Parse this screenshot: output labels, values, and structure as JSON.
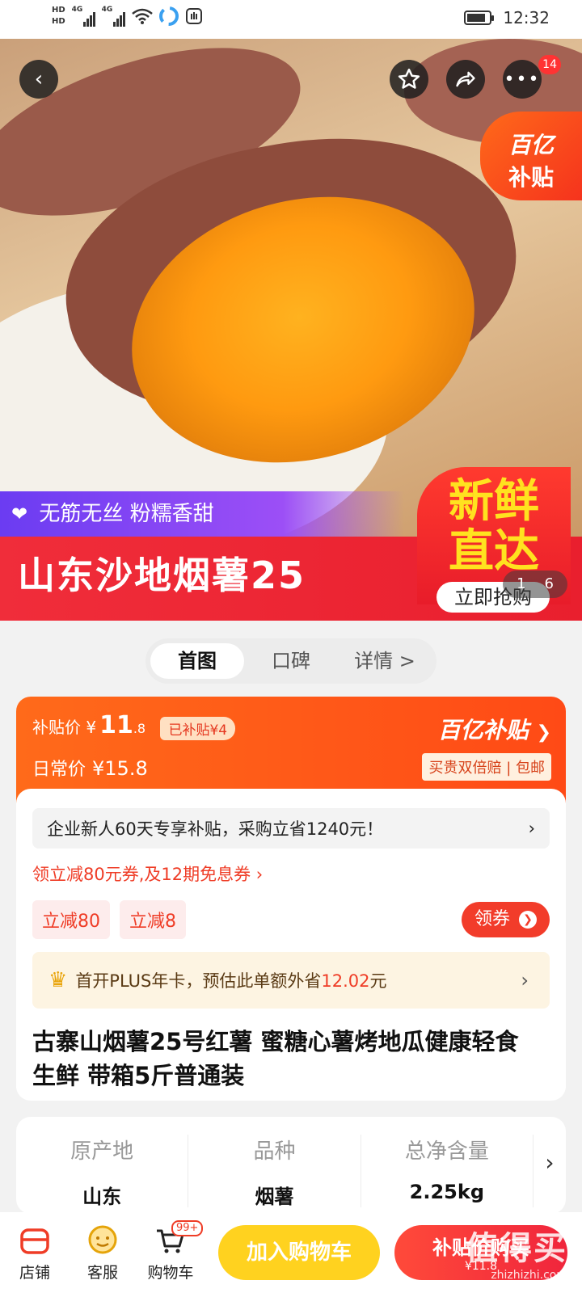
{
  "status_bar": {
    "hd1": "HD",
    "hd2": "HD",
    "net1": "4G",
    "net2": "4G",
    "time": "12:32"
  },
  "hero": {
    "badge_count": "14",
    "yi_badge_line1": "百亿",
    "yi_badge_line2": "补贴",
    "tagline": "无筋无丝  粉糯香甜",
    "title": "山东沙地烟薯25",
    "fresh_line1": "新鲜",
    "fresh_line2": "直达",
    "grab_button": "立即抢购",
    "pager_current": "1",
    "pager_total": "6"
  },
  "tabs": [
    {
      "label": "首图",
      "active": true
    },
    {
      "label": "口碑",
      "active": false
    },
    {
      "label": "详情 >",
      "active": false
    }
  ],
  "price": {
    "subsidy_label": "补贴价",
    "currency": "¥",
    "subsidy_int": "11",
    "subsidy_dec": ".8",
    "subsidy_chip": "已补贴¥4",
    "daily_label": "日常价",
    "daily_value": "¥15.8",
    "yi_title": "百亿补贴",
    "yi_sub": "买贵双倍赔 | 包邮"
  },
  "promo": {
    "enterprise_text": "企业新人60天专享补贴，采购立省1240元！",
    "coupon_line": "领立减80元券,及12期免息券 ›",
    "chips": [
      "立减80",
      "立减8"
    ],
    "claim_button": "领券",
    "plus_prefix": "首开PLUS年卡，预估此单额外省",
    "plus_amount": "12.02",
    "plus_suffix": "元"
  },
  "product_title": "古寨山烟薯25号红薯 蜜糖心薯烤地瓜健康轻食 生鲜 带箱5斤普通装",
  "specs": [
    {
      "key": "原产地",
      "value": "山东"
    },
    {
      "key": "品种",
      "value": "烟薯"
    },
    {
      "key": "总净含量",
      "value": "2.25kg"
    }
  ],
  "bottom_bar": {
    "store": "店铺",
    "service": "客服",
    "cart": "购物车",
    "cart_badge": "99+",
    "add_to_cart": "加入购物车",
    "buy_label": "补贴价购买",
    "buy_price": "¥11.8"
  },
  "watermark": {
    "text": "值得买",
    "url": "zhizhizhi.com"
  },
  "colors": {
    "accent_red": "#f02d3a",
    "accent_orange": "#ff6a1a",
    "cart_yellow": "#ffd21f"
  }
}
